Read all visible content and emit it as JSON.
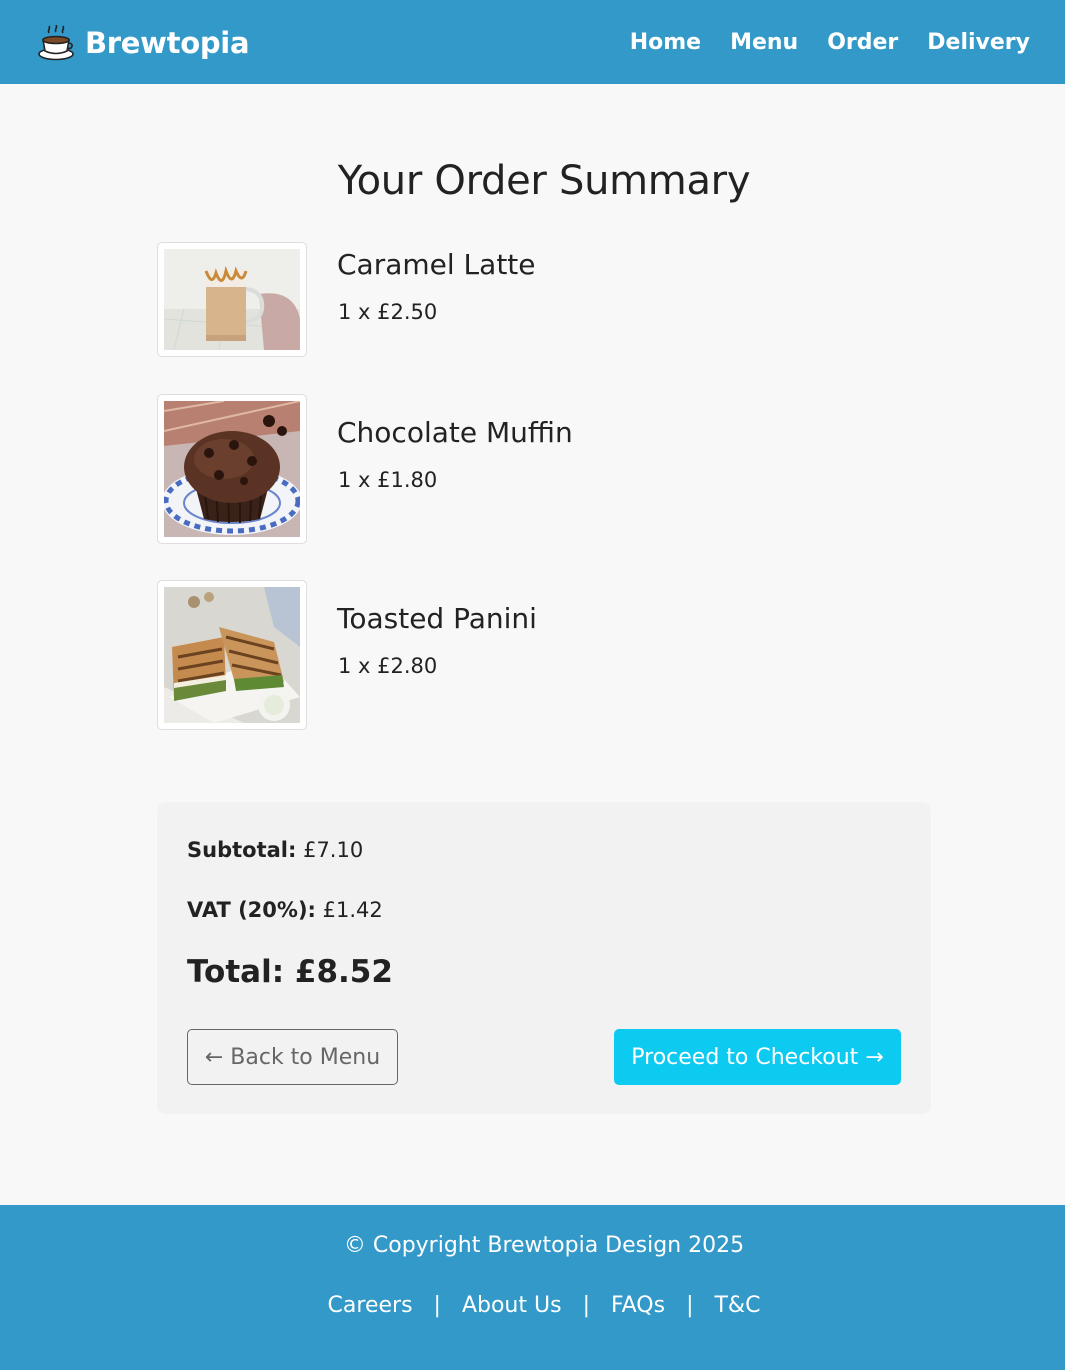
{
  "header": {
    "brand": "Brewtopia",
    "brand_icon": "coffee-cup-icon",
    "nav": [
      "Home",
      "Menu",
      "Order",
      "Delivery"
    ]
  },
  "main": {
    "title": "Your Order Summary",
    "items": [
      {
        "name": "Caramel Latte",
        "qty_price": "1 x £2.50",
        "image": "caramel-latte-photo"
      },
      {
        "name": "Chocolate Muffin",
        "qty_price": "1 x £1.80",
        "image": "chocolate-muffin-photo"
      },
      {
        "name": "Toasted Panini",
        "qty_price": "1 x £2.80",
        "image": "toasted-panini-photo"
      }
    ]
  },
  "summary": {
    "subtotal_label": "Subtotal:",
    "subtotal_value": "£7.10",
    "vat_label": "VAT (20%):",
    "vat_value": "£1.42",
    "total_label": "Total:",
    "total_value": "£8.52",
    "back_button": "← Back to Menu",
    "checkout_button": "Proceed to Checkout →"
  },
  "footer": {
    "copyright": "© Copyright Brewtopia Design 2025",
    "links": [
      "Careers",
      "About Us",
      "FAQs",
      "T&C"
    ],
    "separator": "|"
  },
  "colors": {
    "header_bg": "#3399c9",
    "footer_bg": "#3399c9",
    "checkout_button": "#0dcaf0",
    "summary_bg": "#f2f2f2",
    "page_bg": "#f8f8f8"
  }
}
